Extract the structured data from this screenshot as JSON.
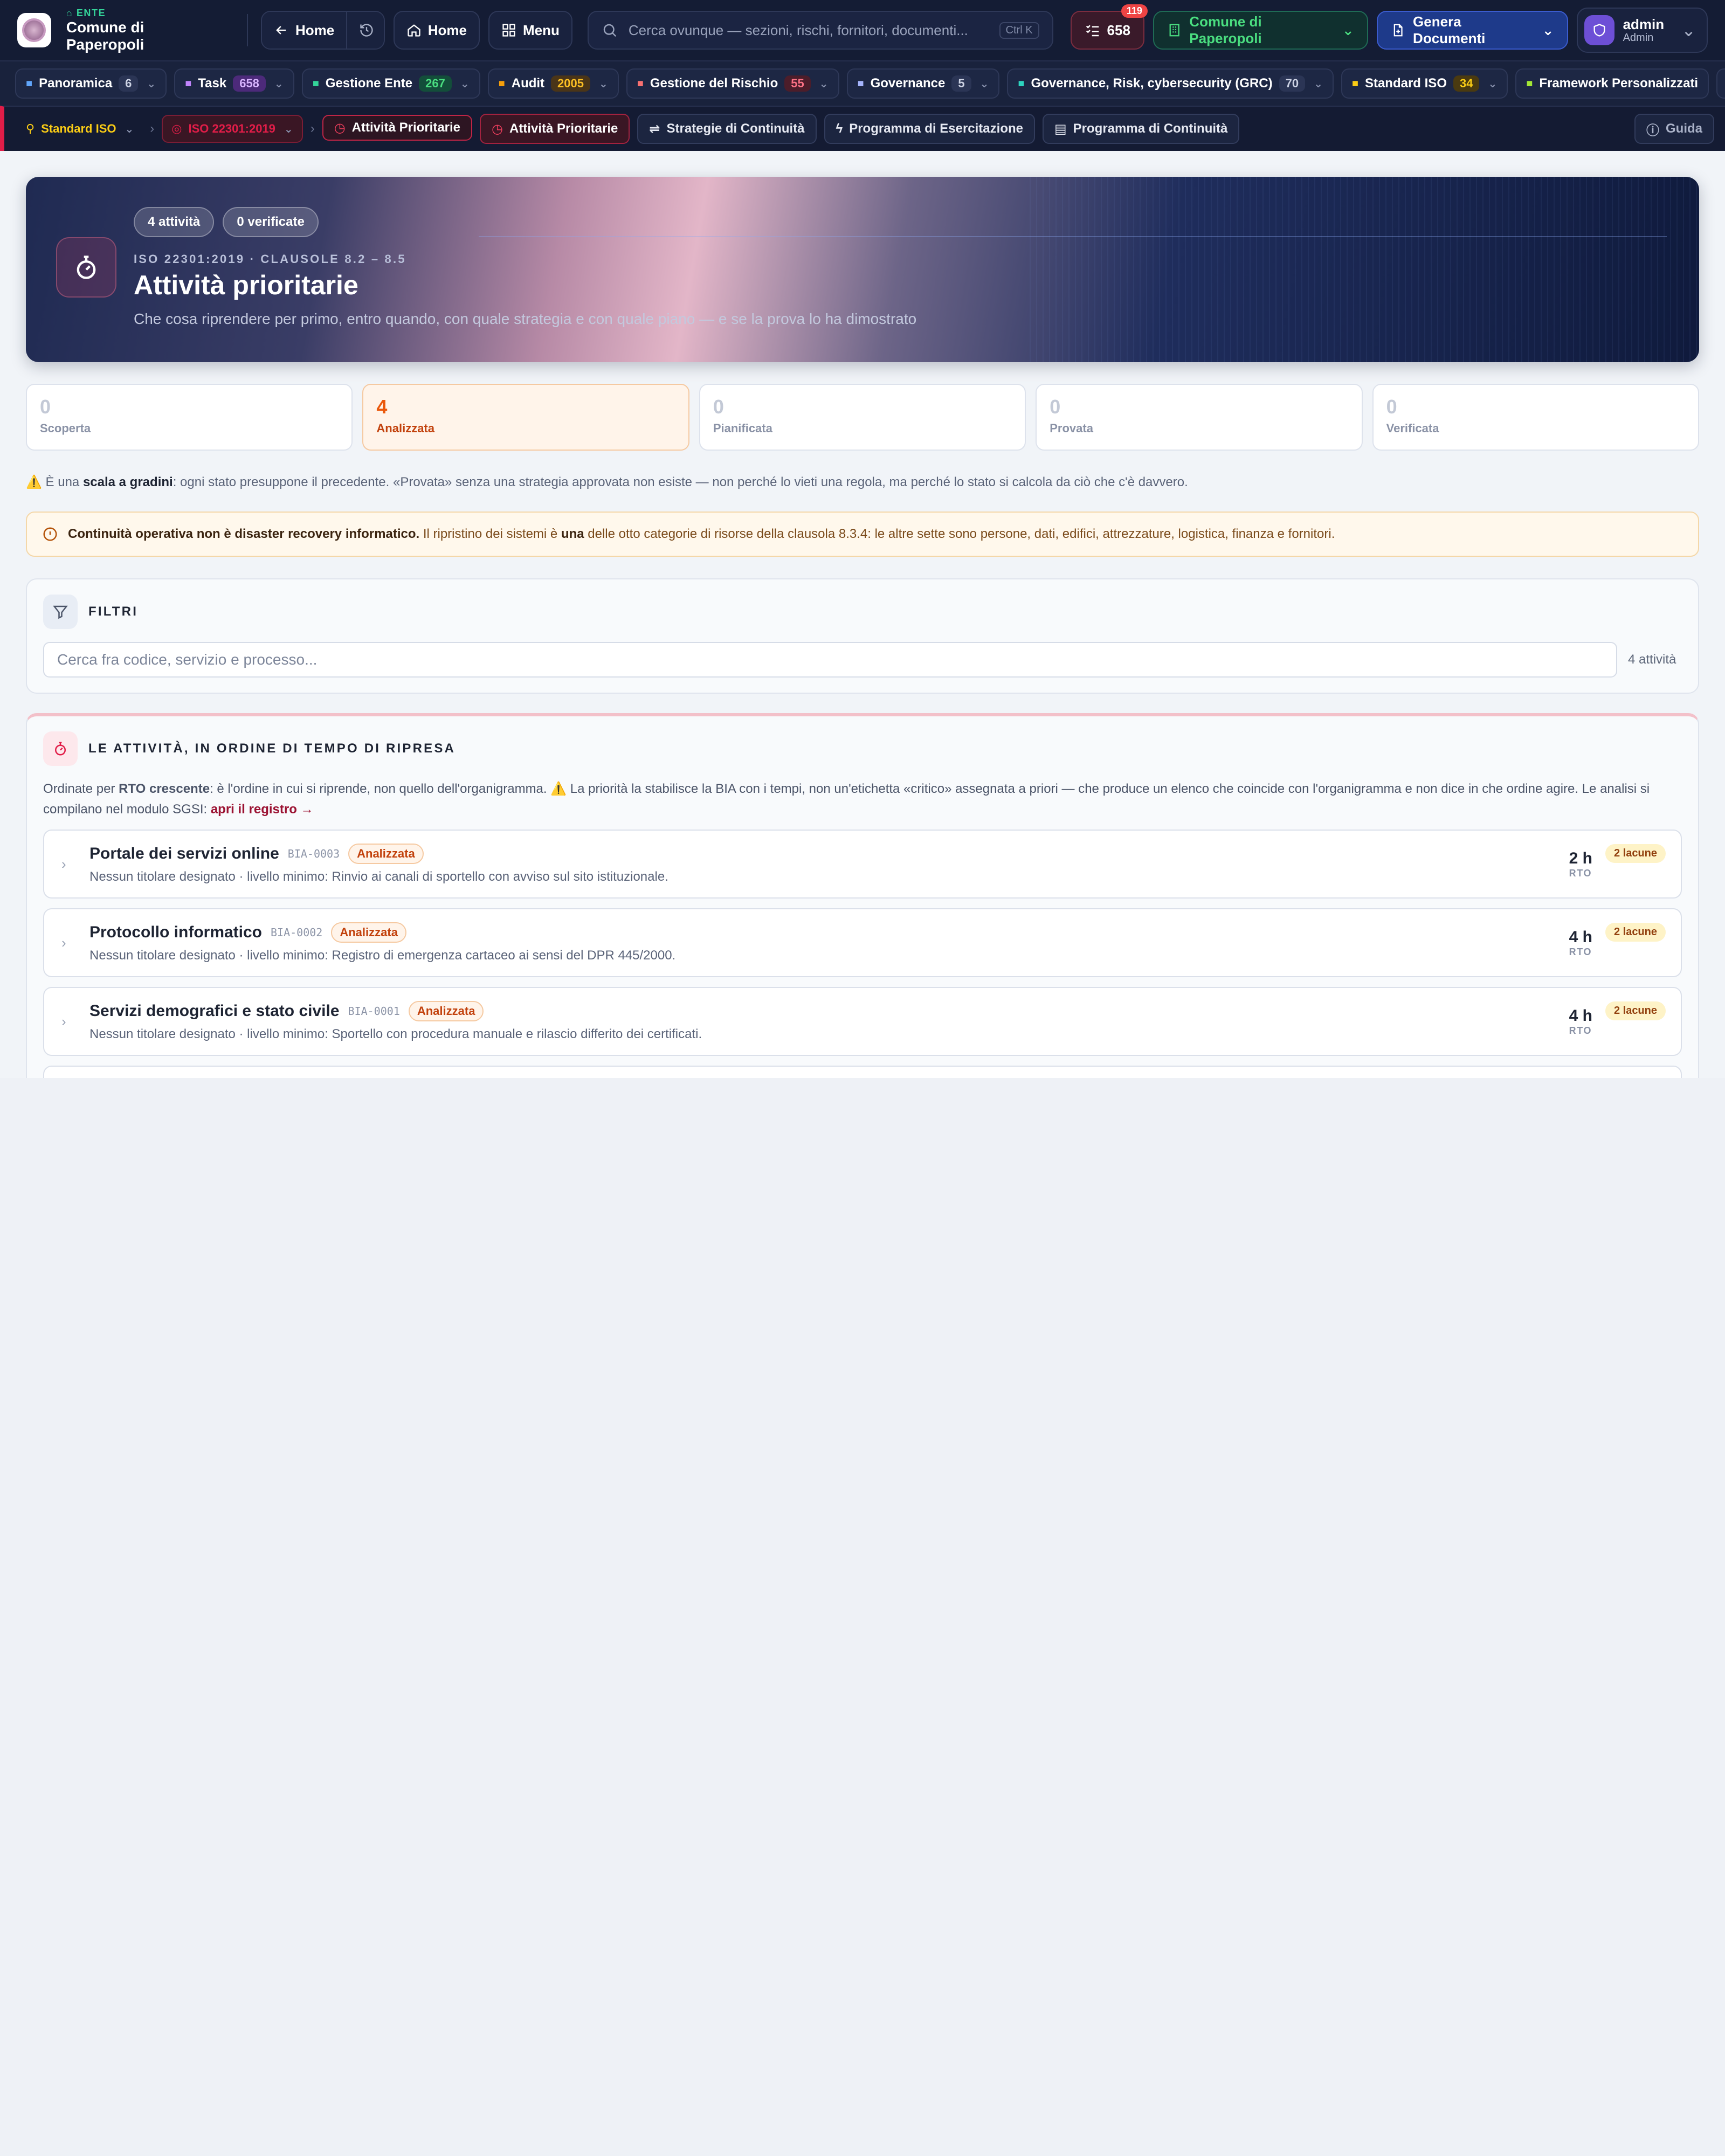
{
  "topbar": {
    "ente_tag": "ENTE",
    "ente_name": "Comune di Paperopoli",
    "back_home": "Home",
    "home": "Home",
    "menu": "Menu",
    "search_placeholder": "Cerca ovunque — sezioni, rischi, fornitori, documenti...",
    "search_shortcut": "Ctrl K",
    "tasks_count": "658",
    "tasks_badge": "119",
    "ente_selector": "Comune di Paperopoli",
    "generate_docs": "Genera Documenti",
    "user_name": "admin",
    "user_role": "Admin"
  },
  "modules": [
    {
      "label": "Panoramica",
      "count": "6",
      "count_color": "#2b3555",
      "count_text": "#cdd3e4",
      "icon_color": "#60a5fa"
    },
    {
      "label": "Task",
      "count": "658",
      "count_color": "#4c2a7a",
      "count_text": "#d8b4fe",
      "icon_color": "#c084fc"
    },
    {
      "label": "Gestione Ente",
      "count": "267",
      "count_color": "#134e3a",
      "count_text": "#4ade80",
      "icon_color": "#34d399"
    },
    {
      "label": "Audit",
      "count": "2005",
      "count_color": "#4a3518",
      "count_text": "#fbbf24",
      "icon_color": "#f59e0b"
    },
    {
      "label": "Gestione del Rischio",
      "count": "55",
      "count_color": "#4c1d2a",
      "count_text": "#fb7185",
      "icon_color": "#f87171"
    },
    {
      "label": "Governance",
      "count": "5",
      "count_color": "#2b3555",
      "count_text": "#cdd3e4",
      "icon_color": "#a5b4fc"
    },
    {
      "label": "Governance, Risk, cybersecurity (GRC)",
      "count": "70",
      "count_color": "#2b3555",
      "count_text": "#cdd3e4",
      "icon_color": "#2dd4bf"
    },
    {
      "label": "Standard ISO",
      "count": "34",
      "count_color": "#4a3a10",
      "count_text": "#facc15",
      "icon_color": "#facc15"
    },
    {
      "label": "Framework Personalizzati",
      "count": "",
      "icon_color": "#a3e635"
    }
  ],
  "subnav": {
    "crumb_standard": "Standard ISO",
    "crumb_iso": "ISO 22301:2019",
    "crumb_current": "Attività Prioritarie",
    "tabs": [
      "Attività Prioritarie",
      "Strategie di Continuità",
      "Programma di Esercitazione",
      "Programma di Continuità"
    ],
    "help": "Guida"
  },
  "hero": {
    "pill_activities": "4 attività",
    "pill_verified": "0 verificate",
    "kicker": "ISO 22301:2019 · CLAUSOLE 8.2 – 8.5",
    "title": "Attività prioritarie",
    "subtitle": "Che cosa riprendere per primo, entro quando, con quale strategia e con quale piano — e se la prova lo ha dimostrato"
  },
  "stats": [
    {
      "value": "0",
      "label": "Scoperta"
    },
    {
      "value": "4",
      "label": "Analizzata"
    },
    {
      "value": "0",
      "label": "Pianificata"
    },
    {
      "value": "0",
      "label": "Provata"
    },
    {
      "value": "0",
      "label": "Verificata"
    }
  ],
  "ladder_note": {
    "prefix": "⚠️ È una ",
    "bold": "scala a gradini",
    "rest": ": ogni stato presuppone il precedente. «Provata» senza una strategia approvata non esiste — non perché lo vieti una regola, ma perché lo stato si calcola da ciò che c'è davvero."
  },
  "warning": {
    "bold": "Continuità operativa non è disaster recovery informatico.",
    "text1": " Il ripristino dei sistemi è ",
    "bold2": "una",
    "text2": " delle otto categorie di risorse della clausola 8.3.4: le altre sette sono persone, dati, edifici, attrezzature, logistica, finanza e fornitori."
  },
  "filters": {
    "title": "FILTRI",
    "placeholder": "Cerca fra codice, servizio e processo...",
    "count": "4 attività"
  },
  "activities_card": {
    "title": "LE ATTIVITÀ, IN ORDINE DI TEMPO DI RIPRESA",
    "desc_prefix": "Ordinate per ",
    "desc_bold": "RTO crescente",
    "desc_rest": ": è l'ordine in cui si riprende, non quello dell'organigramma. ⚠️ La priorità la stabilisce la BIA con i tempi, non un'etichetta «critico» assegnata a priori — che produce un elenco che coincide con l'organigramma e non dice in che ordine agire. Le analisi si compilano nel modulo SGSI: ",
    "desc_link": "apri il registro →",
    "rows": [
      {
        "name": "Portale dei servizi online",
        "code": "BIA-0003",
        "status": "Analizzata",
        "detail": "Nessun titolare designato · livello minimo: Rinvio ai canali di sportello con avviso sul sito istituzionale.",
        "rto": "2 h",
        "rto_label": "RTO",
        "gaps": "2 lacune"
      },
      {
        "name": "Protocollo informatico",
        "code": "BIA-0002",
        "status": "Analizzata",
        "detail": "Nessun titolare designato · livello minimo: Registro di emergenza cartaceo ai sensi del DPR 445/2000.",
        "rto": "4 h",
        "rto_label": "RTO",
        "gaps": "2 lacune"
      },
      {
        "name": "Servizi demografici e stato civile",
        "code": "BIA-0001",
        "status": "Analizzata",
        "detail": "Nessun titolare designato · livello minimo: Sportello con procedura manuale e rilascio differito dei certificati.",
        "rto": "4 h",
        "rto_label": "RTO",
        "gaps": "2 lacune"
      }
    ]
  }
}
